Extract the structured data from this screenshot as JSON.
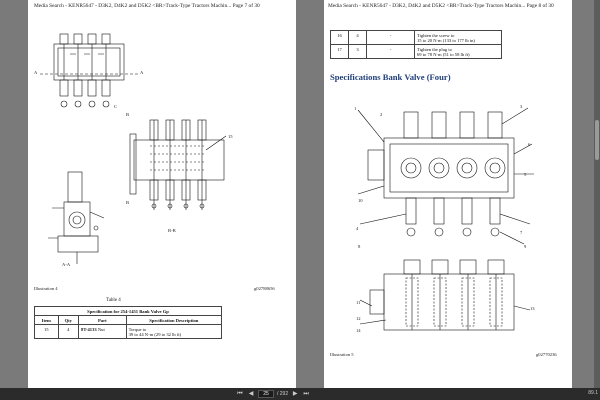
{
  "left_page": {
    "header": "Media Search - KENR5647 - D3K2, D4K2 and D5K2 <BR>Track-Type Tractors Machin... Page 7 of 30",
    "callouts": {
      "a_left": "A",
      "a_right": "A",
      "b_top": "B",
      "b_bottom": "B",
      "c": "C",
      "sect_a": "A-A",
      "sect_b": "B-B",
      "num_15": "15"
    },
    "illustration_caption": "Illustration 4",
    "illustration_code": "g02788656",
    "table_label": "Table 4",
    "table": {
      "title": "Specification for 254-1451 Bank Valve Gp",
      "headers": [
        "Item",
        "Qty",
        "Part",
        "Specification Description"
      ],
      "rows": [
        {
          "item": "15",
          "qty": "4",
          "part": "8T-4133",
          "part_suffix": " Nut",
          "desc_line1": "Torque to",
          "desc_line2": "39 to 44 N·m (29 to 32 lb ft)"
        }
      ]
    }
  },
  "right_page": {
    "header": "Media Search - KENR5647 - D3K2, D4K2 and D5K2 <BR>Track-Type Tractors Machin... Page 8 of 30",
    "table": {
      "rows": [
        {
          "item": "16",
          "qty": "4",
          "part": "-",
          "desc_line1": "Tighten the screw to",
          "desc_line2": "15 to 20 N·m (133 to 177 lb in)"
        },
        {
          "item": "17",
          "qty": "3",
          "part": "-",
          "desc_line1": "Tighten the plug to",
          "desc_line2": "69 to 78 N·m (51 to 58 lb ft)"
        }
      ]
    },
    "section_title": "Specifications Bank Valve (Four)",
    "callouts": [
      "1",
      "2",
      "3",
      "4",
      "5",
      "6",
      "7",
      "8",
      "9",
      "10",
      "11",
      "12",
      "13",
      "14"
    ],
    "illustration_caption": "Illustration 5",
    "illustration_code": "g02770236"
  },
  "statusbar": {
    "current_page": "25",
    "total_pages": "/ 292",
    "zoom": "89.1"
  },
  "icons": [
    "first-page-icon",
    "prev-page-icon",
    "next-page-icon",
    "last-page-icon"
  ]
}
